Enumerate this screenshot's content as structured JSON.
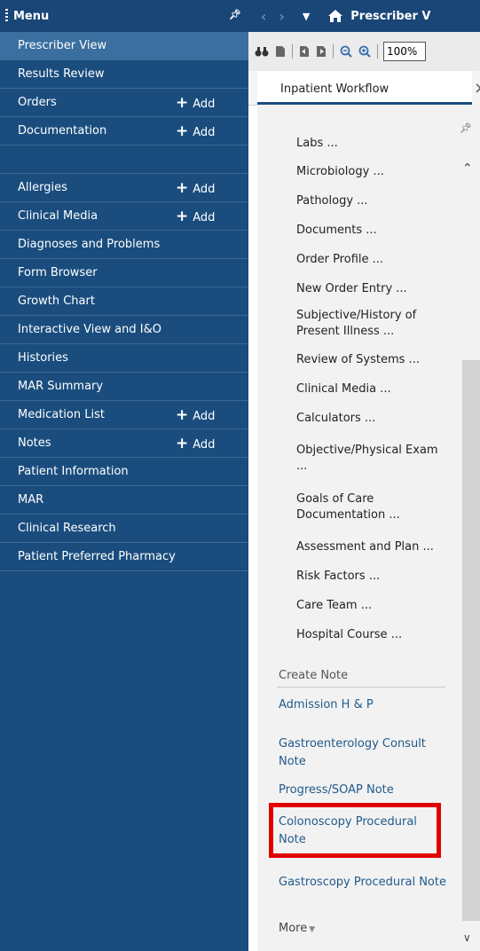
{
  "menu": {
    "title": "Menu",
    "items": [
      {
        "label": "Prescriber View",
        "selected": true
      },
      {
        "label": "Results Review"
      },
      {
        "label": "Orders",
        "add": "Add"
      },
      {
        "label": "Documentation",
        "add": "Add"
      },
      {
        "label": ""
      },
      {
        "label": "Allergies",
        "add": "Add"
      },
      {
        "label": "Clinical Media",
        "add": "Add"
      },
      {
        "label": "Diagnoses and Problems"
      },
      {
        "label": "Form Browser"
      },
      {
        "label": "Growth Chart"
      },
      {
        "label": "Interactive View and I&O"
      },
      {
        "label": "Histories"
      },
      {
        "label": "MAR Summary"
      },
      {
        "label": "Medication List",
        "add": "Add"
      },
      {
        "label": "Notes",
        "add": "Add"
      },
      {
        "label": "Patient Information"
      },
      {
        "label": "MAR"
      },
      {
        "label": "Clinical Research"
      },
      {
        "label": "Patient Preferred Pharmacy"
      }
    ]
  },
  "header": {
    "title": "Prescriber V"
  },
  "toolbar": {
    "zoom": "100%"
  },
  "tab": {
    "label": "Inpatient Workflow",
    "close": "×"
  },
  "workflow": {
    "partial_top": "Labs ...",
    "links": [
      "Microbiology ...",
      "Pathology ...",
      "Documents ...",
      "Order Profile ...",
      "New Order Entry ...",
      "Subjective/History of Present Illness ...",
      "Review of Systems ...",
      "Clinical Media ...",
      "Calculators ...",
      "Objective/Physical Exam ...",
      "Goals of Care Documentation ...",
      "Assessment and Plan ...",
      "Risk Factors ...",
      "Care Team ...",
      "Hospital Course ..."
    ],
    "create_note": {
      "label": "Create Note",
      "notes": [
        "Admission H & P",
        "Gastroenterology Consult Note",
        "Progress/SOAP Note",
        "Colonoscopy Procedural Note",
        "Gastroscopy Procedural Note"
      ],
      "more": "More"
    }
  },
  "colors": {
    "menu_bg": "#1a4d7e",
    "menu_selected": "#3a6f9f",
    "link_blue": "#1f5a8c",
    "highlight": "#e00000"
  }
}
